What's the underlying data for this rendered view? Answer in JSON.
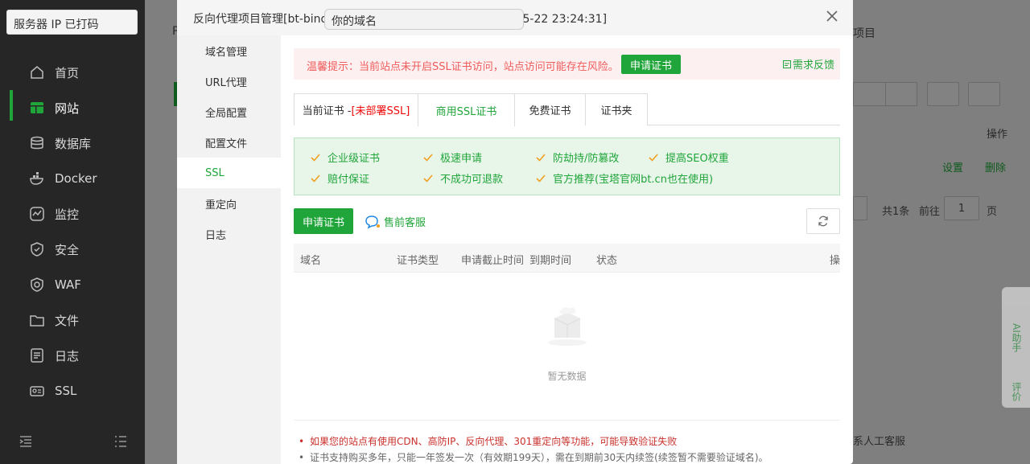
{
  "sidebar": {
    "server_ip": "服务器 IP 已打码",
    "items": [
      {
        "label": "首页",
        "icon": "home-icon"
      },
      {
        "label": "网站",
        "icon": "website-icon"
      },
      {
        "label": "数据库",
        "icon": "database-icon"
      },
      {
        "label": "Docker",
        "icon": "docker-icon"
      },
      {
        "label": "监控",
        "icon": "monitor-icon"
      },
      {
        "label": "安全",
        "icon": "shield-icon"
      },
      {
        "label": "WAF",
        "icon": "waf-icon"
      },
      {
        "label": "文件",
        "icon": "folder-icon"
      },
      {
        "label": "日志",
        "icon": "log-icon"
      },
      {
        "label": "SSL",
        "icon": "ssl-icon"
      }
    ]
  },
  "background": {
    "project_tab": "项目",
    "ops_header": "操作",
    "settings_link": "设置",
    "delete_link": "删除",
    "pagination_total": "共1条",
    "pagination_goto": "前往",
    "pagination_page": "1",
    "pagination_unit": "页",
    "contact": "系人工客服",
    "first_letter": "P"
  },
  "ai_helper": {
    "label": "AI助手",
    "review": "评价"
  },
  "modal": {
    "title_prefix": "反向代理项目管理[bt-bind-",
    "title_suffix": "5-22 23:24:31]",
    "domain_overlay": "你的域名",
    "nav": [
      "域名管理",
      "URL代理",
      "全局配置",
      "配置文件",
      "SSL",
      "重定向",
      "日志"
    ],
    "active_nav": "SSL",
    "alert": {
      "text": "温馨提示：当前站点未开启SSL证书访问，站点访问可能存在风险。",
      "button": "申请证书",
      "feedback": "需求反馈"
    },
    "tabs": {
      "current_prefix": "当前证书 -",
      "current_status": "[未部署SSL]",
      "commercial": "商用SSL证书",
      "free": "免费证书",
      "folder": "证书夹"
    },
    "features": [
      "企业级证书",
      "极速申请",
      "防劫持/防篡改",
      "提高SEO权重",
      "赔付保证",
      "不成功可退款",
      "官方推荐(宝塔官网bt.cn也在使用)"
    ],
    "apply_button": "申请证书",
    "presale": "售前客服",
    "table": {
      "columns": [
        "域名",
        "证书类型",
        "申请截止时间",
        "到期时间",
        "状态",
        "操"
      ],
      "empty": "暂无数据"
    },
    "notes": [
      "如果您的站点有使用CDN、高防IP、反向代理、301重定向等功能，可能导致验证失败",
      "证书支持购买多年，只能一年签发一次（有效期199天），需在到期前30天内续签(续签暂不需要验证域名)。"
    ]
  },
  "colors": {
    "accent": "#20a53a",
    "danger": "#ef5c5c",
    "sidebar_bg": "#262626"
  }
}
